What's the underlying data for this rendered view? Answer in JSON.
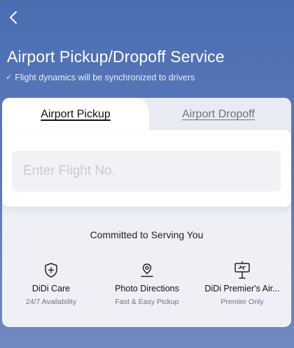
{
  "header": {
    "title": "Airport Pickup/Dropoff Service",
    "subtitle_check": "✓",
    "subtitle": "Flight dynamics will be synchronized to drivers"
  },
  "tabs": [
    {
      "label": "Airport Pickup",
      "active": true
    },
    {
      "label": "Airport Dropoff",
      "active": false
    }
  ],
  "flight_input": {
    "value": "",
    "placeholder": "Enter Flight No."
  },
  "section_title": "Committed to Serving You",
  "features": [
    {
      "icon": "shield-plus-icon",
      "name": "DiDi Care",
      "desc": "24/7 Availability"
    },
    {
      "icon": "location-pin-icon",
      "name": "Photo Directions",
      "desc": "Fast & Easy Pickup"
    },
    {
      "icon": "airport-sign-icon",
      "name": "DiDi Premier's Air...",
      "desc": "Premier Only"
    }
  ],
  "colors": {
    "background_top": "#4a6db2",
    "background_bottom": "#7188c0",
    "card": "#eef0f6",
    "panel": "#ffffff",
    "input_bg": "#f1f2f6"
  }
}
